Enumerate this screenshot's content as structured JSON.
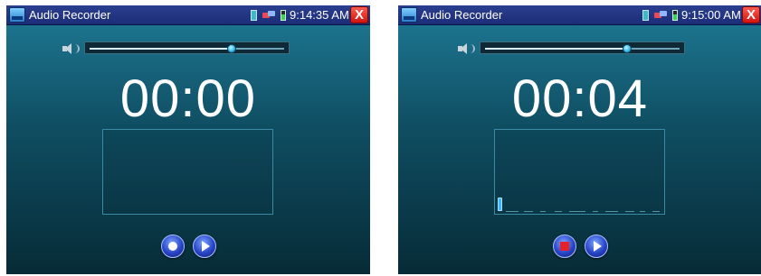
{
  "screens": [
    {
      "app_title": "Audio Recorder",
      "clock": "9:14:35 AM",
      "close_label": "X",
      "volume_level": 0.73,
      "timer": "00:00",
      "state": "stopped",
      "icons": [
        "app-icon",
        "sd-card-icon",
        "network-icon",
        "battery-icon",
        "close-icon",
        "speaker-icon",
        "record-icon",
        "play-icon"
      ]
    },
    {
      "app_title": "Audio Recorder",
      "clock": "9:15:00 AM",
      "close_label": "X",
      "volume_level": 0.73,
      "timer": "00:04",
      "state": "recording",
      "icons": [
        "app-icon",
        "sd-card-icon",
        "network-icon",
        "battery-icon",
        "close-icon",
        "speaker-icon",
        "stop-icon",
        "play-icon"
      ]
    }
  ],
  "colors": {
    "titlebar": "#1c2d77",
    "background_top": "#1f7a96",
    "background_bottom": "#072b37",
    "close_button": "#d0140e",
    "control_button": "#2844c8",
    "level_bar": "#3fb6ff",
    "stop_red": "#e8202a"
  }
}
